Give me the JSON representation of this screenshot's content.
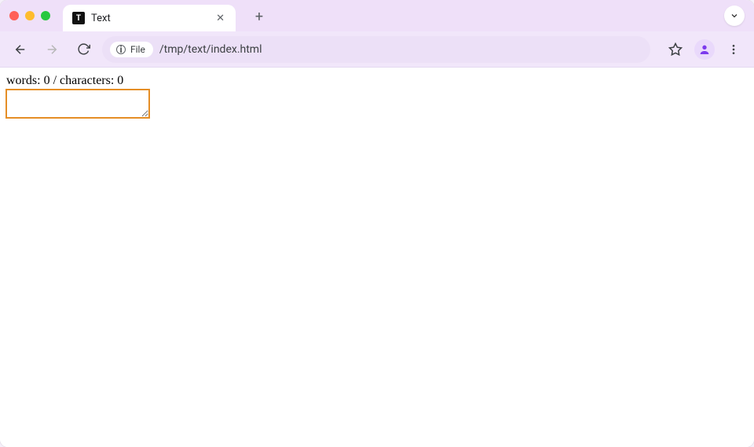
{
  "window": {
    "tab_title": "Text",
    "favicon_letter": "T"
  },
  "toolbar": {
    "url_chip_label": "File",
    "url": "/tmp/text/index.html"
  },
  "page": {
    "counter_prefix_words": "words: ",
    "word_count": "0",
    "counter_sep": " / ",
    "counter_prefix_chars": "characters: ",
    "char_count": "0",
    "textarea_value": ""
  }
}
